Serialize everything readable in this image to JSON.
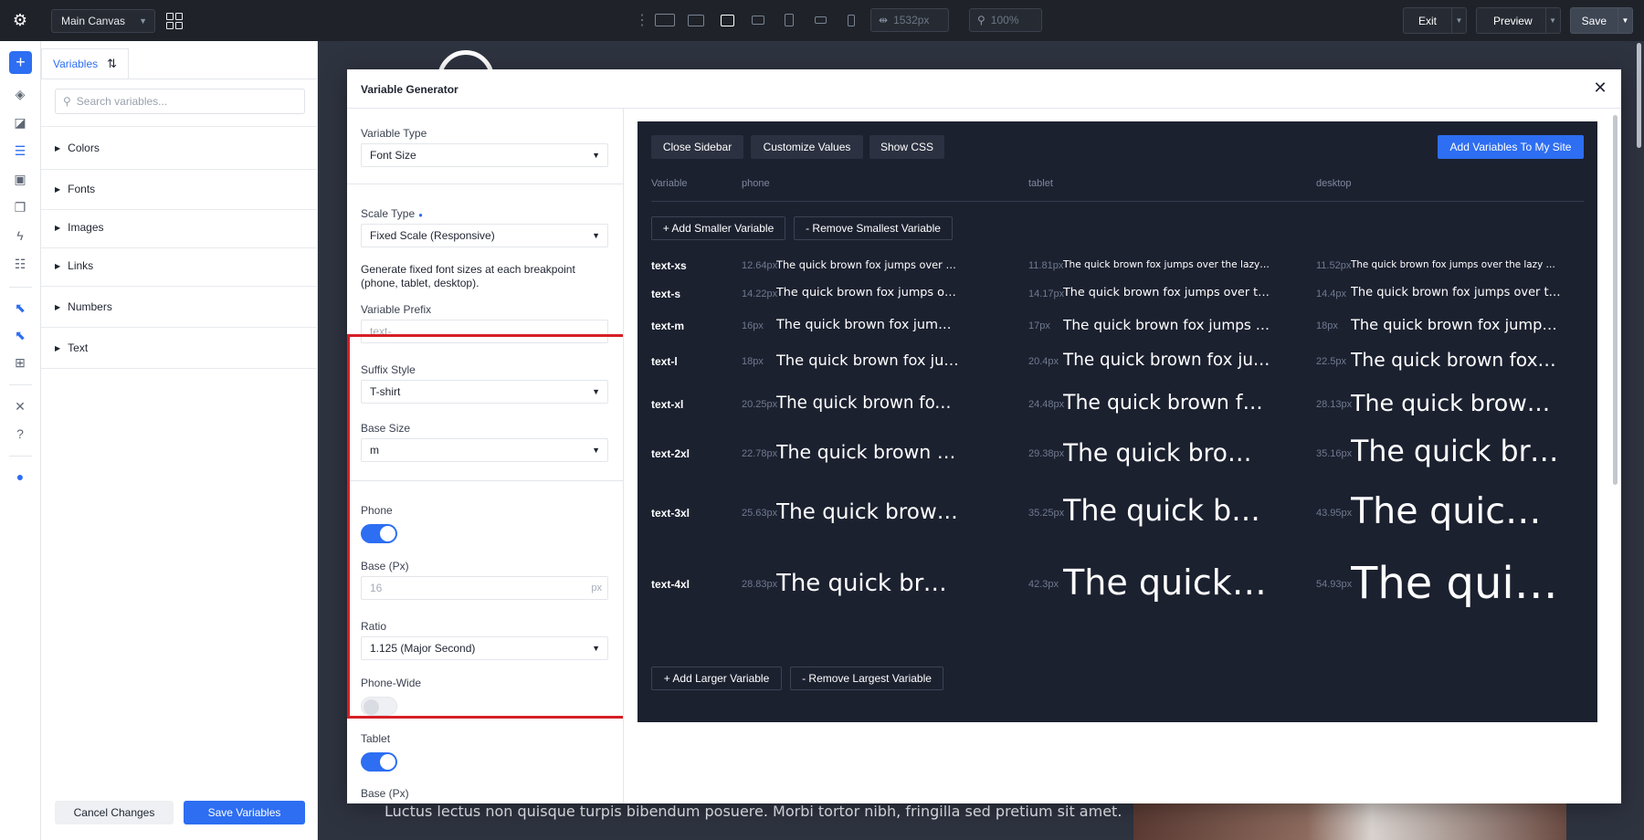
{
  "topbar": {
    "canvas_select": "Main Canvas",
    "width_value": "1532px",
    "zoom_value": "100%",
    "exit_label": "Exit",
    "preview_label": "Preview",
    "save_label": "Save"
  },
  "variables_panel": {
    "tab_label": "Variables",
    "search_placeholder": "Search variables...",
    "groups": [
      "Colors",
      "Fonts",
      "Images",
      "Links",
      "Numbers",
      "Text"
    ],
    "cancel_label": "Cancel Changes",
    "save_label": "Save Variables"
  },
  "canvas": {
    "body_text": "Luctus lectus non quisque turpis bibendum posuere. Morbi tortor nibh, fringilla sed pretium sit amet."
  },
  "modal": {
    "title": "Variable Generator",
    "form": {
      "variable_type_label": "Variable Type",
      "variable_type_value": "Font Size",
      "scale_type_label": "Scale Type",
      "scale_type_value": "Fixed Scale (Responsive)",
      "scale_description": "Generate fixed font sizes at each breakpoint (phone, tablet, desktop).",
      "prefix_label": "Variable Prefix",
      "prefix_placeholder": "text-",
      "suffix_label": "Suffix Style",
      "suffix_value": "T-shirt",
      "base_size_label": "Base Size",
      "base_size_value": "m",
      "phone_label": "Phone",
      "phone_enabled": true,
      "base_px_label": "Base (Px)",
      "base_px_placeholder": "16",
      "base_px_unit": "px",
      "ratio_label": "Ratio",
      "ratio_value": "1.125 (Major Second)",
      "phone_wide_label": "Phone-Wide",
      "phone_wide_enabled": false,
      "tablet_label": "Tablet",
      "tablet_enabled": true,
      "tablet_base_label": "Base (Px)"
    },
    "preview": {
      "close_sidebar_label": "Close Sidebar",
      "customize_label": "Customize Values",
      "show_css_label": "Show CSS",
      "add_to_site_label": "Add Variables To My Site",
      "headers": {
        "variable": "Variable",
        "phone": "phone",
        "tablet": "tablet",
        "desktop": "desktop"
      },
      "add_smaller_label": "+ Add Smaller Variable",
      "remove_smallest_label": "- Remove Smallest Variable",
      "add_larger_label": "+ Add Larger Variable",
      "remove_largest_label": "- Remove Largest Variable",
      "sample_text": "The quick brown fox jumps over the lazy dog",
      "rows": [
        {
          "name": "text-xs",
          "phone": "12.64px",
          "tablet": "11.81px",
          "desktop": "11.52px"
        },
        {
          "name": "text-s",
          "phone": "14.22px",
          "tablet": "14.17px",
          "desktop": "14.4px"
        },
        {
          "name": "text-m",
          "phone": "16px",
          "tablet": "17px",
          "desktop": "18px"
        },
        {
          "name": "text-l",
          "phone": "18px",
          "tablet": "20.4px",
          "desktop": "22.5px"
        },
        {
          "name": "text-xl",
          "phone": "20.25px",
          "tablet": "24.48px",
          "desktop": "28.13px"
        },
        {
          "name": "text-2xl",
          "phone": "22.78px",
          "tablet": "29.38px",
          "desktop": "35.16px"
        },
        {
          "name": "text-3xl",
          "phone": "25.63px",
          "tablet": "35.25px",
          "desktop": "43.95px"
        },
        {
          "name": "text-4xl",
          "phone": "28.83px",
          "tablet": "42.3px",
          "desktop": "54.93px"
        }
      ]
    }
  },
  "colors": {
    "accent": "#2d6ef2",
    "highlight": "#d61f26",
    "preview_bg": "#1c2130"
  }
}
